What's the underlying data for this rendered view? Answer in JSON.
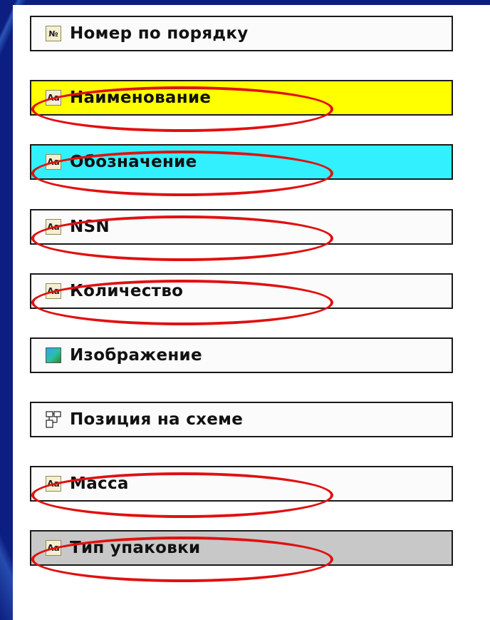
{
  "fields": [
    {
      "label": "Номер по порядку",
      "icon": "number-sign-icon",
      "icon_text": "№",
      "bg": "#fbfbfb",
      "highlighted": false
    },
    {
      "label": "Наименование",
      "icon": "text-field-icon",
      "icon_text": "Aa",
      "bg": "#ffff00",
      "highlighted": true
    },
    {
      "label": "Обозначение",
      "icon": "text-field-icon",
      "icon_text": "Aa",
      "bg": "#33f0ff",
      "highlighted": true
    },
    {
      "label": "NSN",
      "icon": "text-field-icon",
      "icon_text": "Aa",
      "bg": "#fbfbfb",
      "highlighted": true
    },
    {
      "label": "Количество",
      "icon": "text-field-icon",
      "icon_text": "Aa",
      "bg": "#fbfbfb",
      "highlighted": true
    },
    {
      "label": "Изображение",
      "icon": "image-field-icon",
      "icon_text": "",
      "bg": "#fbfbfb",
      "highlighted": false
    },
    {
      "label": "Позиция на схеме",
      "icon": "schematic-position-icon",
      "icon_text": "",
      "bg": "#fbfbfb",
      "highlighted": false
    },
    {
      "label": "Масса",
      "icon": "text-field-icon",
      "icon_text": "Aa",
      "bg": "#fbfbfb",
      "highlighted": true
    },
    {
      "label": "Тип упаковки",
      "icon": "text-field-icon",
      "icon_text": "Aa",
      "bg": "#c8c8c8",
      "highlighted": true
    }
  ],
  "colors": {
    "background_blue": "#0c1f80",
    "highlight_ellipse": "#e01010",
    "yellow_field": "#ffff00",
    "cyan_field": "#33f0ff",
    "gray_field": "#c8c8c8"
  }
}
